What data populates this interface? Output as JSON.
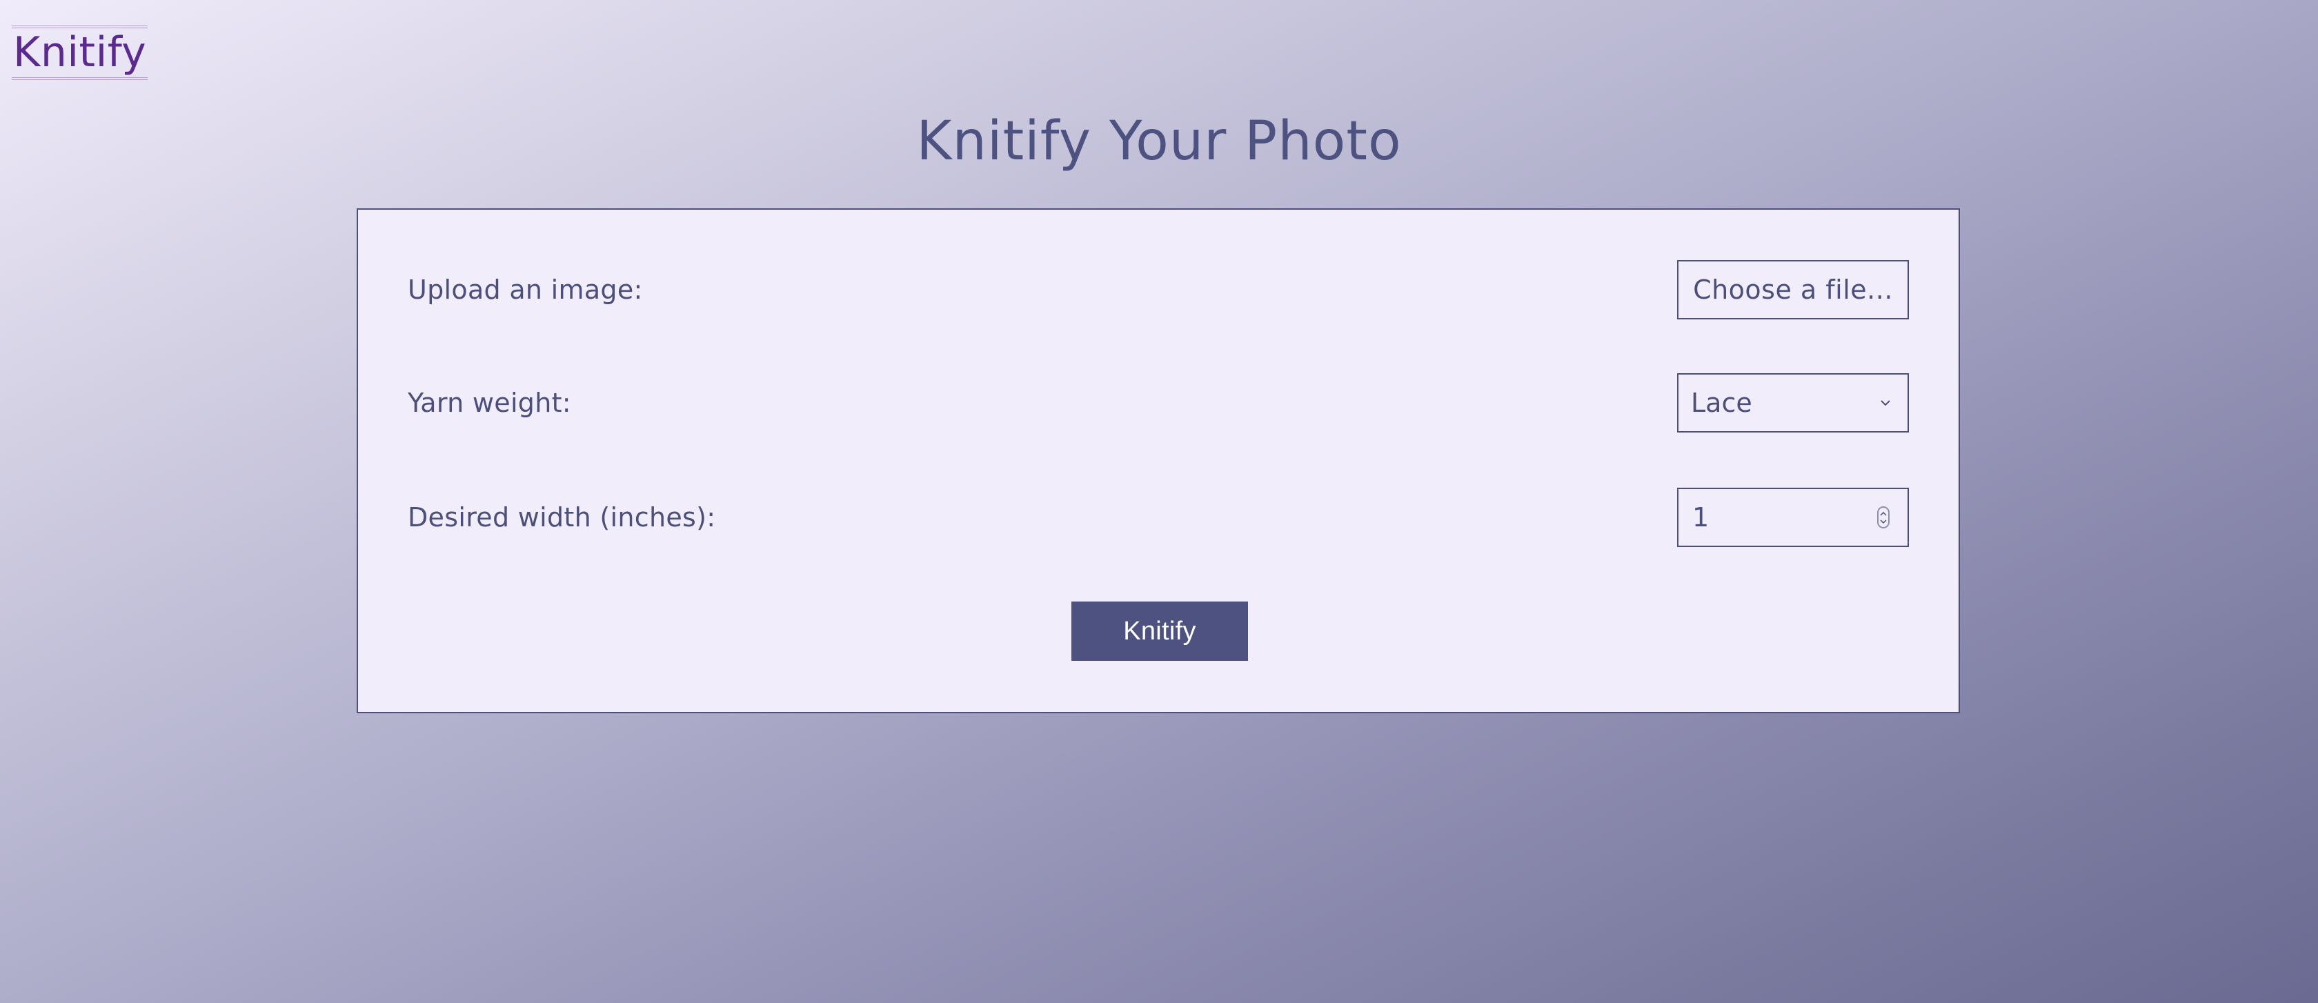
{
  "brand": {
    "logo_text": "Knitify"
  },
  "page": {
    "title": "Knitify Your Photo"
  },
  "form": {
    "upload": {
      "label": "Upload an image:",
      "button_label": "Choose a file..."
    },
    "yarn_weight": {
      "label": "Yarn weight:",
      "selected": "Lace"
    },
    "width": {
      "label": "Desired width (inches):",
      "value": "1"
    },
    "submit_label": "Knitify"
  },
  "colors": {
    "primary": "#4d5281",
    "card_background": "#f2edfb",
    "logo": "#5a2b8c"
  },
  "icons": {
    "select_indicator": "chevron-down-icon",
    "number_spinner": "spinner-icon"
  }
}
